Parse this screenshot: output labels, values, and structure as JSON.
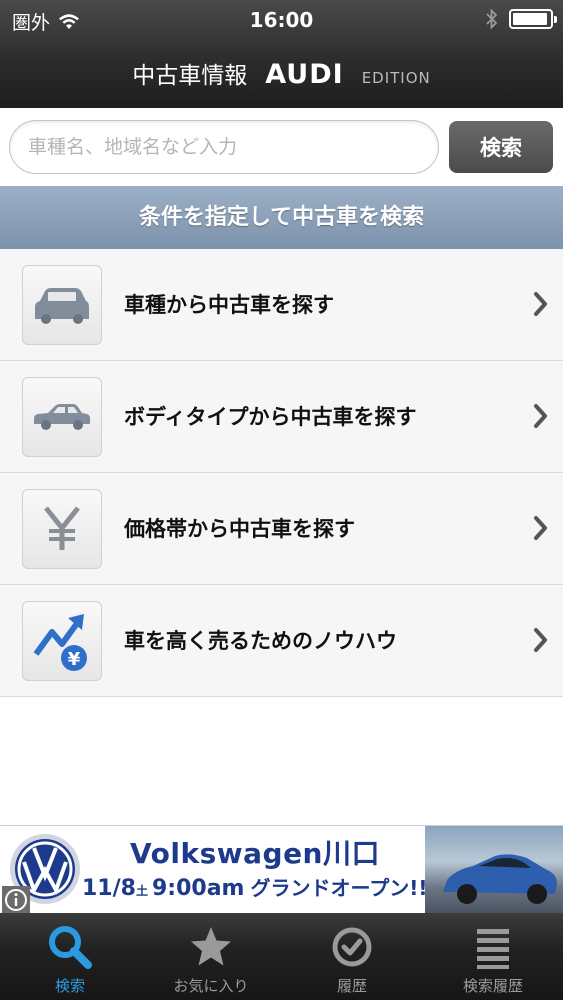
{
  "status_bar": {
    "carrier": "圏外",
    "time": "16:00",
    "battery_level": 0.95,
    "icons": [
      "wifi-icon",
      "bluetooth-icon",
      "battery-icon"
    ]
  },
  "header": {
    "title": "中古車情報",
    "brand": "AUDI",
    "edition": "EDITION"
  },
  "search": {
    "placeholder": "車種名、地域名など入力",
    "value": "",
    "button_label": "検索"
  },
  "section_header": "条件を指定して中古車を検索",
  "menu": {
    "items": [
      {
        "label": "車種から中古車を探す",
        "icon": "car-front-icon"
      },
      {
        "label": "ボディタイプから中古車を探す",
        "icon": "car-side-icon"
      },
      {
        "label": "価格帯から中古車を探す",
        "icon": "yen-icon"
      },
      {
        "label": "車を高く売るためのノウハウ",
        "icon": "price-up-arrow-icon"
      }
    ]
  },
  "ad": {
    "line1": "Volkswagen川口",
    "line2": "11/8",
    "line2_day": "土",
    "line2_time": "9:00am",
    "line2_tail": "グランドオープン!!"
  },
  "tabbar": {
    "tabs": [
      {
        "label": "検索",
        "icon": "search-icon",
        "active": true
      },
      {
        "label": "お気に入り",
        "icon": "star-icon",
        "active": false
      },
      {
        "label": "履歴",
        "icon": "check-circle-icon",
        "active": false
      },
      {
        "label": "検索履歴",
        "icon": "list-icon",
        "active": false
      }
    ]
  },
  "colors": {
    "header_bg": "#2a2a2a",
    "section_header_bg": "#8a9eb6",
    "active_tab": "#2a9be0",
    "ad_text": "#1d3a8c"
  }
}
